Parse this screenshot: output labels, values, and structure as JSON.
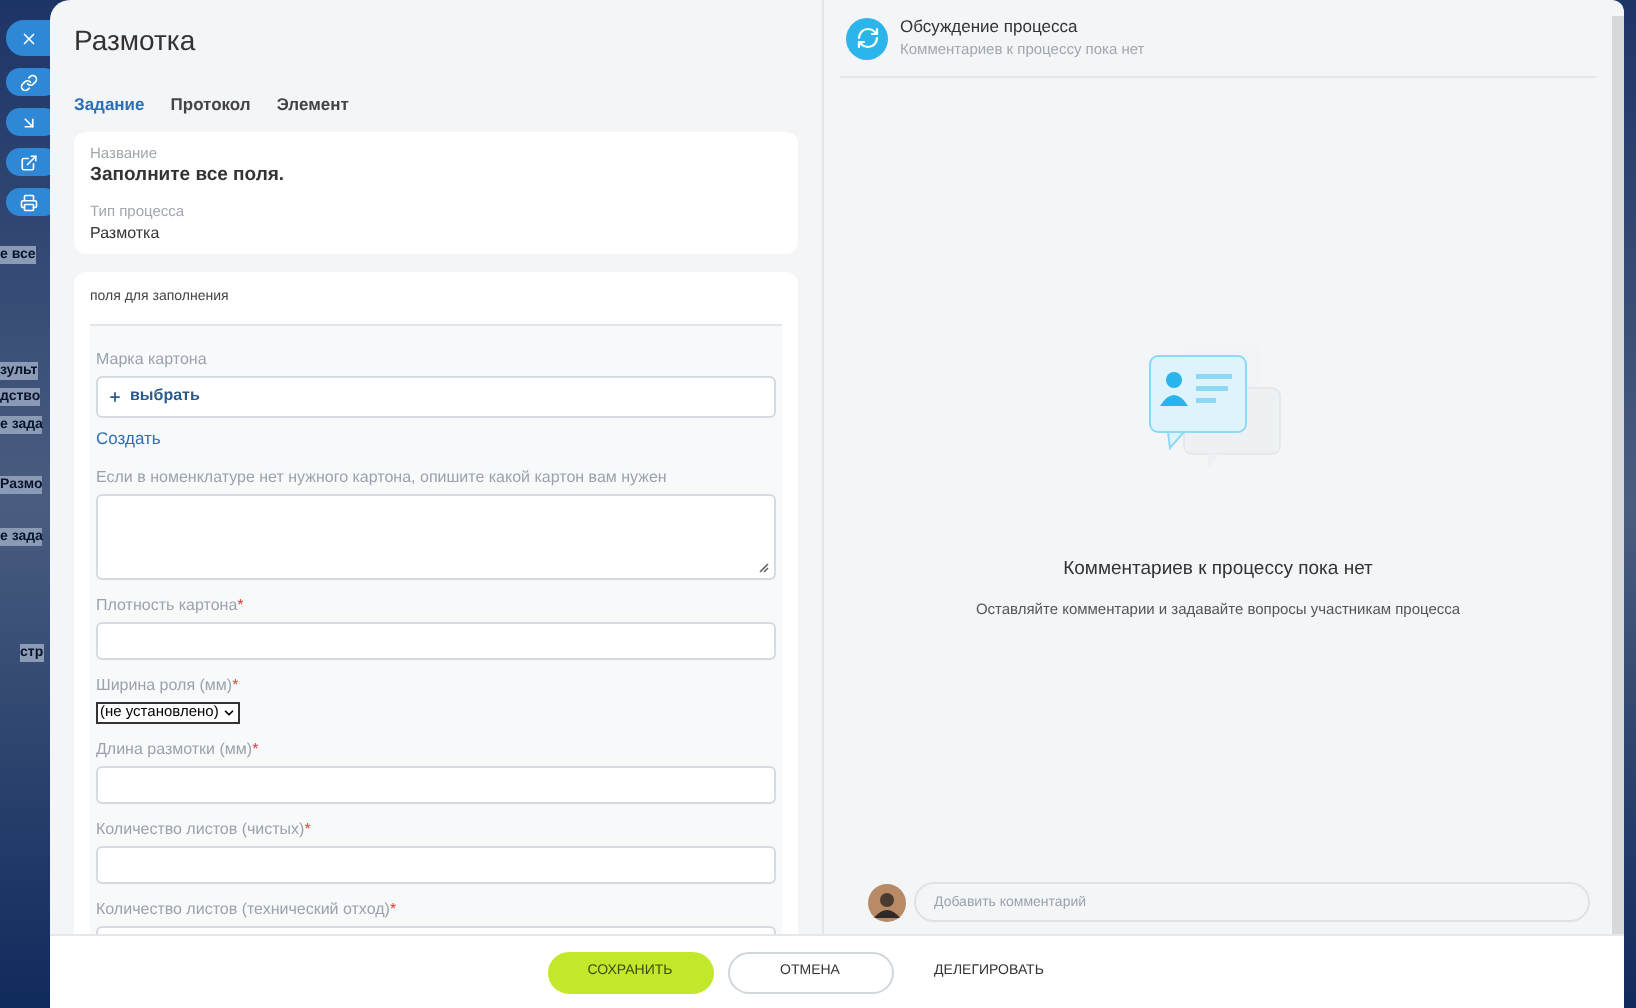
{
  "background": {
    "fragments": [
      "е все",
      "зульт",
      "дство",
      "е зада",
      "Размо",
      "е зада",
      "стр"
    ],
    "side_buttons": [
      {
        "kind": "close"
      },
      {
        "kind": "link"
      },
      {
        "kind": "arrow"
      },
      {
        "kind": "external"
      },
      {
        "kind": "print"
      }
    ]
  },
  "dialog": {
    "title": "Размотка",
    "tabs": [
      {
        "label": "Задание",
        "selected": true
      },
      {
        "label": "Протокол",
        "selected": false
      },
      {
        "label": "Элемент",
        "selected": false
      }
    ],
    "info": [
      {
        "label": "Название",
        "value": "Заполните все поля.",
        "bold": true
      },
      {
        "label": "Тип процесса",
        "value": "Размотка",
        "bold": false
      }
    ],
    "fields_section": {
      "title": "поля для заполнения",
      "fields": [
        {
          "kind": "lookup",
          "label": "Марка картона",
          "button": "выбрать",
          "link": "Создать"
        },
        {
          "kind": "textarea",
          "label": "Если в номенклатуре нет нужного картона, опишите какой картон вам нужен"
        },
        {
          "kind": "text",
          "label": "Плотность картона",
          "required_mark": "*"
        },
        {
          "kind": "select",
          "label": "Ширина роля (мм)",
          "required_mark": "*",
          "value": "(не установлено)"
        },
        {
          "kind": "text",
          "label": "Длина размотки (мм)",
          "required_mark": "*"
        },
        {
          "kind": "text",
          "label": "Количество листов (чистых)",
          "required_mark": "*"
        },
        {
          "kind": "text",
          "label": "Количество листов (технический отход)",
          "required_mark": "*"
        }
      ]
    },
    "discussion": {
      "title": "Обсуждение процесса",
      "subtitle": "Комментариев к процессу пока нет",
      "empty_title": "Комментариев к процессу пока нет",
      "empty_text": "Оставляйте комментарии и задавайте вопросы участникам процесса",
      "comment_placeholder": "Добавить комментарий"
    },
    "buttons": [
      {
        "kind": "primary",
        "label": "СОХРАНИТЬ"
      },
      {
        "kind": "outline",
        "label": "ОТМЕНА"
      },
      {
        "kind": "text",
        "label": "ДЕЛЕГИРОВАТЬ"
      }
    ]
  }
}
